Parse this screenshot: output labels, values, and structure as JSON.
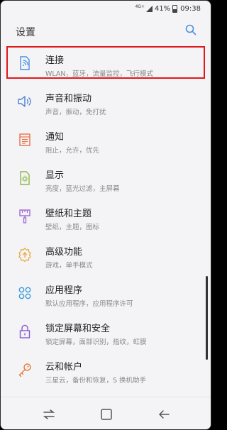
{
  "status": {
    "network": "4G+",
    "battery": "41%",
    "time": "09:38"
  },
  "header": {
    "title": "设置"
  },
  "items": [
    {
      "label": "连接",
      "sub": "WLAN，蓝牙，流量监控，飞行模式"
    },
    {
      "label": "声音和振动",
      "sub": "声音，振动，免打扰"
    },
    {
      "label": "通知",
      "sub": "阻止，允许，优先"
    },
    {
      "label": "显示",
      "sub": "亮度，蓝光过滤，主屏幕"
    },
    {
      "label": "壁纸和主题",
      "sub": "壁纸，主题，图标"
    },
    {
      "label": "高级功能",
      "sub": "游戏，单手模式"
    },
    {
      "label": "应用程序",
      "sub": "默认应用程序，应用程序许可"
    },
    {
      "label": "锁定屏幕和安全",
      "sub": "锁定屏幕，面部识别，指纹，虹膜"
    },
    {
      "label": "云和帐户",
      "sub": "三星云，备份和恢复，S 换机助手"
    }
  ],
  "colors": {
    "accent_blue": "#4a90e2",
    "highlight_red": "#e0171b"
  }
}
